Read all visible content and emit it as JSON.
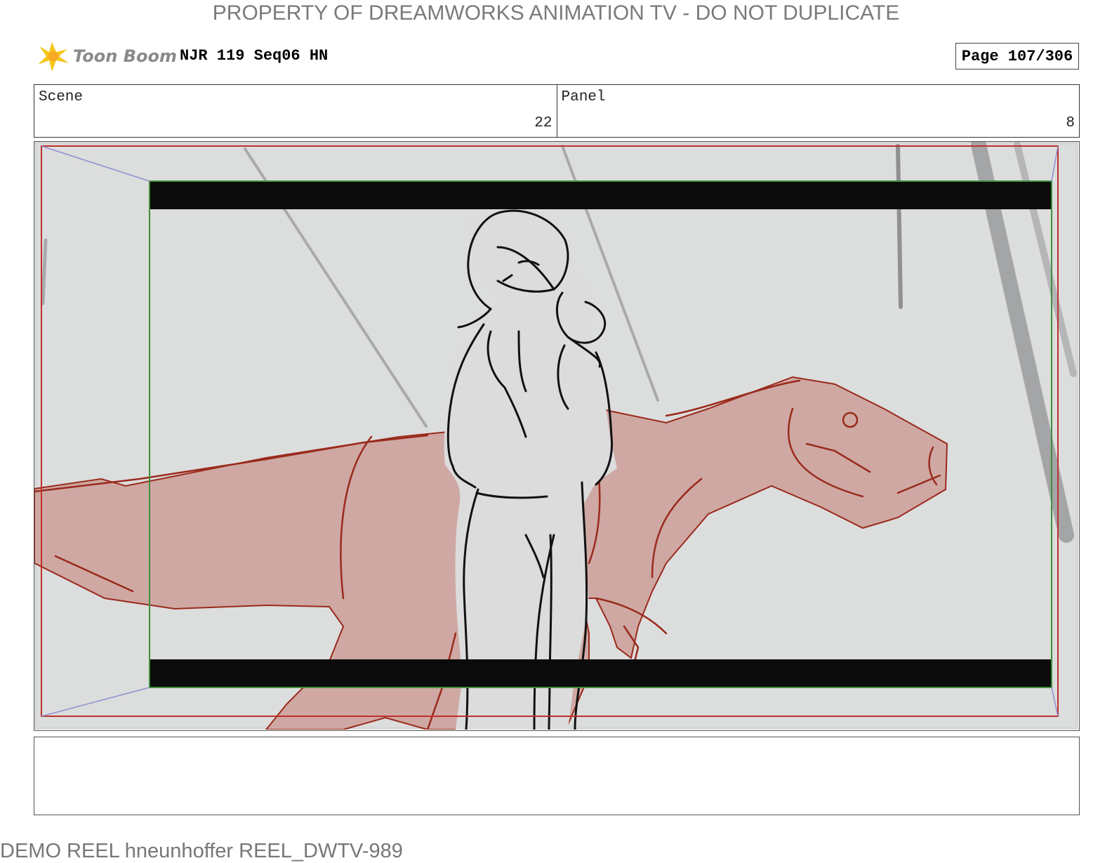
{
  "watermark": "PROPERTY OF DREAMWORKS ANIMATION TV - DO NOT DUPLICATE",
  "logo": {
    "text": "Toon Boom",
    "icon": "toon-boom-star-icon"
  },
  "title": "NJR 119 Seq06 HN",
  "page": "Page 107/306",
  "scene": {
    "label": "Scene",
    "value": "22"
  },
  "panel": {
    "label": "Panel",
    "value": "8"
  },
  "caption": "",
  "footer": "DEMO REEL hneunhoffer REEL_DWTV-989",
  "colors": {
    "frame_red": "#c0302a",
    "safe_green": "#3f8f3a",
    "dino_fill": "#cfa8a3",
    "dino_line": "#9a2a1c",
    "background": "#d6d7d8"
  }
}
